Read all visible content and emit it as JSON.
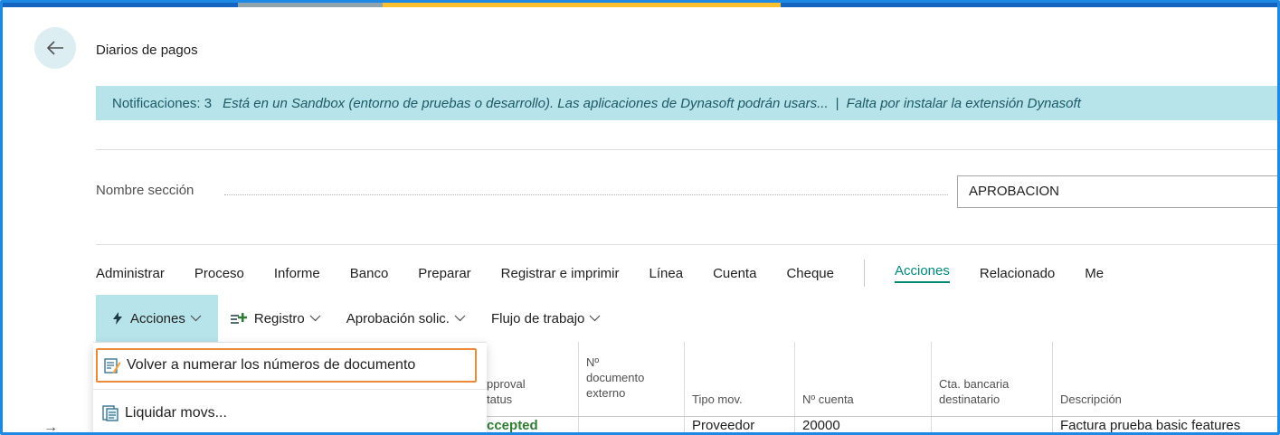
{
  "colors": {
    "accent": "#00897b",
    "notification_bg": "#b7e3ea",
    "frame_border": "#1e88e5",
    "highlight_border": "#e98a3a"
  },
  "header": {
    "back_icon": "arrow-left-icon",
    "title": "Diarios de pagos"
  },
  "notifications": {
    "count_label": "Notificaciones: 3",
    "message_1": "Está en un Sandbox (entorno de pruebas o desarrollo). Las aplicaciones de Dynasoft podrán usars...",
    "separator": "|",
    "message_2": "Falta por instalar la extensión Dynasoft"
  },
  "section": {
    "label": "Nombre sección",
    "value": "APROBACION"
  },
  "menu": {
    "tabs": [
      "Administrar",
      "Proceso",
      "Informe",
      "Banco",
      "Preparar",
      "Registrar e imprimir",
      "Línea",
      "Cuenta",
      "Cheque"
    ],
    "active_tab": "Acciones",
    "after_active": [
      "Relacionado",
      "Me"
    ]
  },
  "subbar": {
    "acciones": "Acciones",
    "registro": "Registro",
    "aprobacion": "Aprobación solic.",
    "flujo": "Flujo de trabajo"
  },
  "dropdown": {
    "items": [
      {
        "label": "Volver a numerar los números de documento",
        "icon": "renumber-document-icon"
      },
      {
        "label": "Liquidar movs...",
        "icon": "apply-entries-icon"
      }
    ]
  },
  "columns": {
    "approval_l1": "pproval",
    "approval_l2": "tatus",
    "docext_l1": "Nº",
    "docext_l2": "documento",
    "docext_l3": "externo",
    "tipo_mov": "Tipo mov.",
    "num_cuenta": "Nº cuenta",
    "cta_l1": "Cta. bancaria",
    "cta_l2": "destinatario",
    "descripcion": "Descripción"
  },
  "row": {
    "approval": "ccepted",
    "tipo_mov": "Proveedor",
    "num_cuenta": "20000",
    "descripcion": "Factura prueba basic features"
  }
}
